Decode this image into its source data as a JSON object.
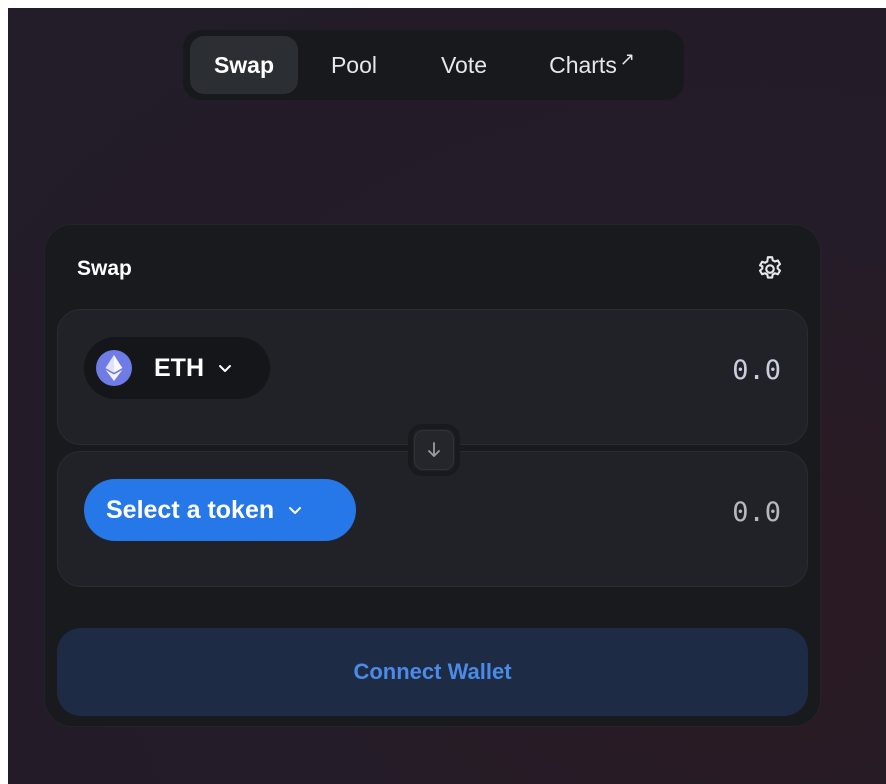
{
  "nav": {
    "items": [
      {
        "label": "Swap",
        "active": true
      },
      {
        "label": "Pool",
        "active": false
      },
      {
        "label": "Vote",
        "active": false
      },
      {
        "label": "Charts",
        "active": false
      }
    ],
    "external_marker": "↗"
  },
  "card": {
    "title": "Swap",
    "settings_icon": "gear-icon",
    "input_panel": {
      "token_symbol": "ETH",
      "token_icon": "ethereum-icon",
      "amount_placeholder": "0.0"
    },
    "output_panel": {
      "select_label": "Select a token",
      "amount_placeholder": "0.0"
    },
    "switch_icon": "arrow-down-icon",
    "connect_label": "Connect Wallet"
  },
  "colors": {
    "accent": "#2677e8",
    "connect_bg": "#1d2b45",
    "connect_text": "#4c8ae7",
    "card_bg": "#191a1e",
    "panel_bg": "#202227",
    "eth_logo": "#6f7ce6"
  }
}
